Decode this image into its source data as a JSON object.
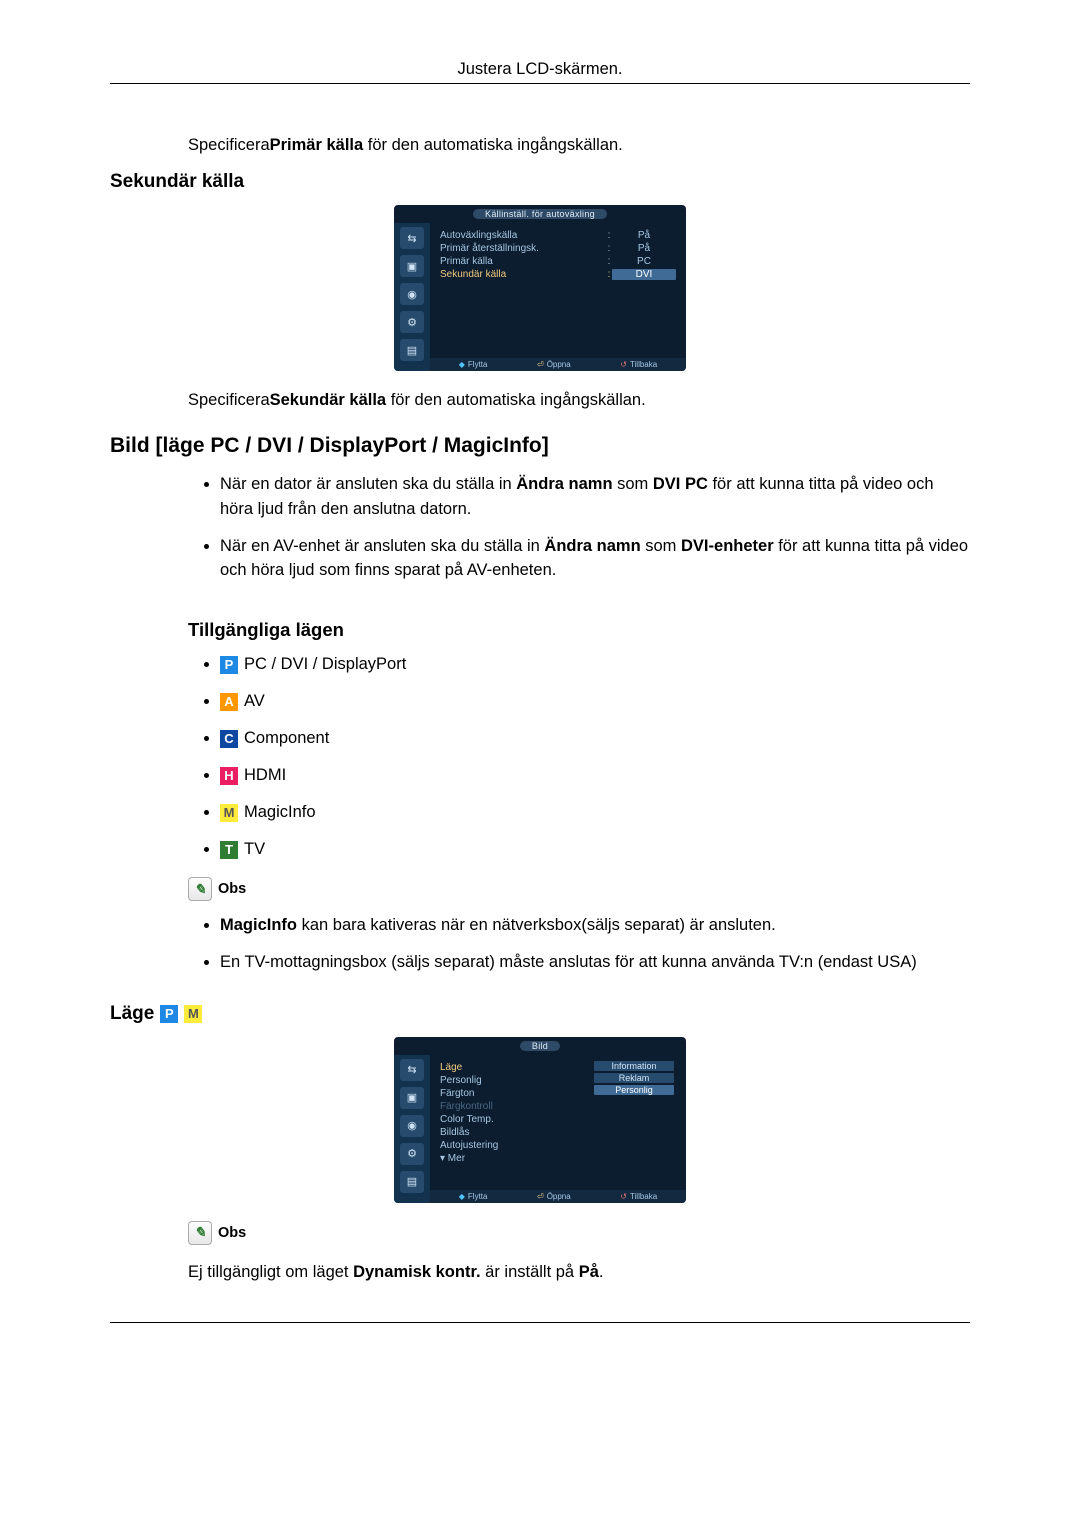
{
  "header": {
    "title": "Justera LCD-skärmen."
  },
  "primar_note": {
    "pre": "Specificera",
    "bold": "Primär källa",
    "post": "  för den automatiska ingångskällan."
  },
  "sekundar": {
    "heading": "Sekundär källa",
    "note_pre": "Specificera",
    "note_bold": "Sekundär källa",
    "note_post": " för den automatiska ingångskällan."
  },
  "osd1": {
    "title": "Källinställ. för autoväxling",
    "rows": [
      {
        "k": "Autoväxlingskälla",
        "v": "På"
      },
      {
        "k": "Primär återställningsk.",
        "v": "På"
      },
      {
        "k": "Primär källa",
        "v": "PC"
      },
      {
        "k": "Sekundär källa",
        "v": "DVI",
        "highlight": true,
        "sel": true
      }
    ],
    "bottom": {
      "move": "Flytta",
      "enter": "Öppna",
      "return": "Tillbaka"
    }
  },
  "bild_heading": "Bild [läge PC / DVI / DisplayPort / MagicInfo]",
  "bild_bullets": [
    {
      "pre": "När en dator är ansluten ska du ställa in ",
      "b1": "Ändra namn",
      "mid": " som ",
      "b2": "DVI PC",
      "post": " för att kunna titta på video och höra ljud från den anslutna datorn."
    },
    {
      "pre": "När en AV-enhet är ansluten ska du ställa in ",
      "b1": "Ändra namn",
      "mid": " som ",
      "b2": "DVI-enheter",
      "post": " för att kunna titta på video och höra ljud som finns sparat på AV-enheten."
    }
  ],
  "modes_heading": "Tillgängliga lägen",
  "modes": [
    {
      "code": "P",
      "label": " PC / DVI / DisplayPort",
      "cls": "icon-P"
    },
    {
      "code": "A",
      "label": " AV",
      "cls": "icon-A"
    },
    {
      "code": "C",
      "label": " Component",
      "cls": "icon-C"
    },
    {
      "code": "H",
      "label": " HDMI",
      "cls": "icon-H"
    },
    {
      "code": "M",
      "label": " MagicInfo",
      "cls": "icon-M"
    },
    {
      "code": "T",
      "label": " TV",
      "cls": "icon-T"
    }
  ],
  "obs_label": "Obs",
  "obs_bullets": [
    {
      "b": "MagicInfo",
      "rest": " kan bara kativeras när en nätverksbox(säljs separat) är ansluten."
    },
    {
      "plain": "En TV-mottagningsbox (säljs separat) måste anslutas för att kunna använda TV:n (endast USA)"
    }
  ],
  "lage": {
    "heading": "Läge"
  },
  "osd2": {
    "title": "Bild",
    "left": [
      {
        "t": "Läge",
        "hl": true
      },
      {
        "t": "Personlig"
      },
      {
        "t": "Färgton"
      },
      {
        "t": "Färgkontroll",
        "dis": true
      },
      {
        "t": "Color Temp."
      },
      {
        "t": "Bildlås"
      },
      {
        "t": "Autojustering"
      },
      {
        "t": "▾ Mer"
      }
    ],
    "right": [
      {
        "t": "Information",
        "alt": true
      },
      {
        "t": "Reklam",
        "alt": true
      },
      {
        "t": "Personlig"
      }
    ],
    "bottom": {
      "move": "Flytta",
      "enter": "Öppna",
      "return": "Tillbaka"
    }
  },
  "final_note": {
    "pre": "Ej tillgängligt om läget ",
    "b1": "Dynamisk kontr.",
    "mid": " är inställt på ",
    "b2": "På",
    "post": "."
  }
}
